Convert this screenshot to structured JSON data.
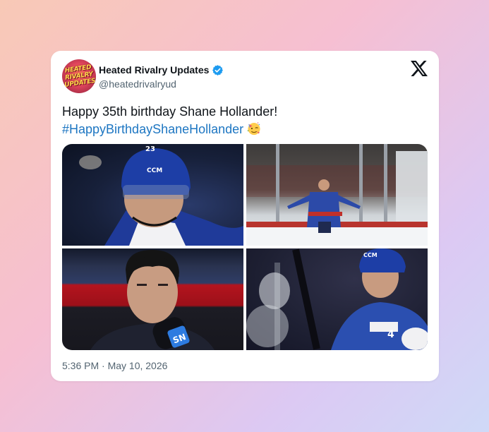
{
  "author": {
    "display_name": "Heated Rivalry Updates",
    "handle": "@heatedrivalryud",
    "avatar_text": "HEATED RIVALRY UPDATES",
    "avatar_lines": [
      "HEATED",
      "RIVALRY",
      "UPDATES"
    ],
    "verified": true
  },
  "tweet": {
    "text": "Happy 35th birthday Shane Hollander!",
    "hashtag": "#HappyBirthdayShaneHollander",
    "emoji": "partying-face",
    "timestamp": "5:36 PM · May 10, 2026"
  },
  "media": [
    {
      "description": "hockey player in blue helmet close-up",
      "jersey_number": "23"
    },
    {
      "description": "player in arena with arms outstretched"
    },
    {
      "description": "player interview in front of red stripe"
    },
    {
      "description": "player on bench in blue jersey",
      "jersey_number": "4"
    }
  ],
  "colors": {
    "hashtag": "#1d76c2",
    "verified_badge": "#1d9bf0",
    "text_primary": "#0f1419",
    "text_secondary": "#536471"
  },
  "icons": [
    "verified-badge-icon",
    "x-logo-icon",
    "partying-face-emoji"
  ]
}
